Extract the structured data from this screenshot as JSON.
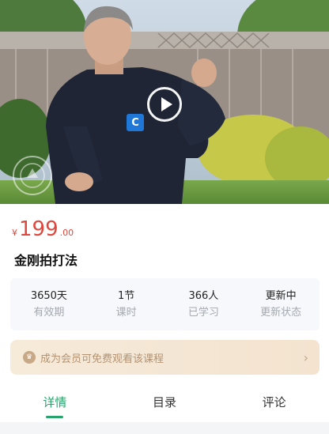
{
  "video": {
    "play_icon": "play-circle-icon",
    "brand_icon": "brand-c-icon",
    "brand_letter": "C",
    "colors": {
      "sky": "#c9d6e2",
      "foliage": "#4d7a3c",
      "grass": "#6d9a45",
      "robe": "#202636"
    }
  },
  "price": {
    "currency": "¥",
    "integer": "199",
    "decimal": ".00",
    "color": "#e0473c"
  },
  "course": {
    "title": "金刚拍打法"
  },
  "stats": [
    {
      "value": "3650天",
      "label": "有效期"
    },
    {
      "value": "1节",
      "label": "课时"
    },
    {
      "value": "366人",
      "label": "已学习"
    },
    {
      "value": "更新中",
      "label": "更新状态"
    }
  ],
  "membership": {
    "text": "成为会员可免费观看该课程",
    "icon": "crown-icon",
    "arrow": "›"
  },
  "tabs": [
    {
      "label": "详情",
      "active": true
    },
    {
      "label": "目录",
      "active": false
    },
    {
      "label": "评论",
      "active": false
    }
  ],
  "accent_color": "#28a36b"
}
